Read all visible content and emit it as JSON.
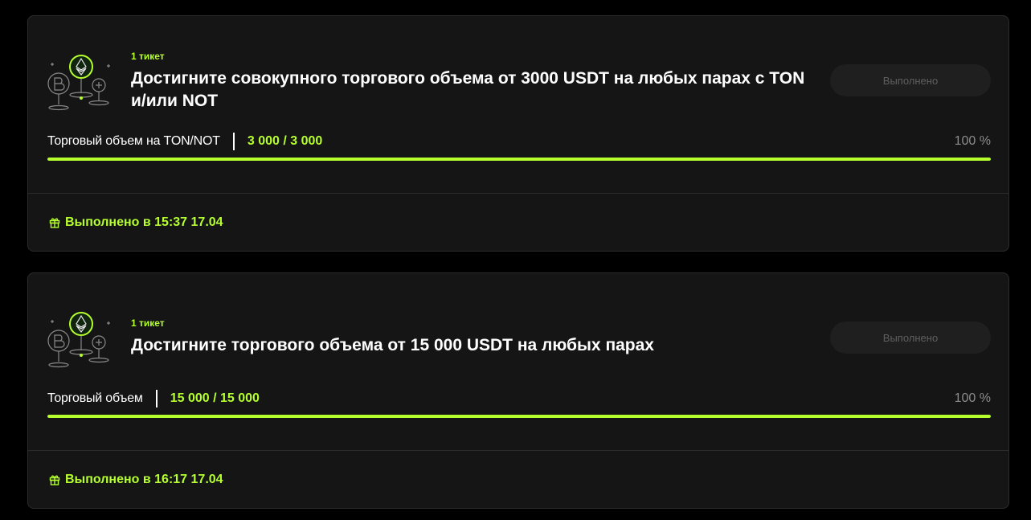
{
  "tasks": [
    {
      "ticket": "1 тикет",
      "title": "Достигните совокупного торгового объема от 3000 USDT на любых парах с TON и/или NOT",
      "button_label": "Выполнено",
      "progress_label": "Торговый объем на TON/NOT",
      "progress_value": "3 000 / 3 000",
      "progress_percent": "100 %",
      "progress_fraction": 1.0,
      "completed_text": "Выполнено в 15:37 17.04",
      "illustration_icon": "crypto-coins-illustration-icon",
      "completed_icon": "gift-icon"
    },
    {
      "ticket": "1 тикет",
      "title": "Достигните торгового объема от 15 000 USDT на любых парах",
      "button_label": "Выполнено",
      "progress_label": "Торговый объем",
      "progress_value": "15 000 / 15 000",
      "progress_percent": "100 %",
      "progress_fraction": 1.0,
      "completed_text": "Выполнено в 16:17 17.04",
      "illustration_icon": "crypto-coins-illustration-icon",
      "completed_icon": "gift-icon"
    }
  ],
  "colors": {
    "accent": "#b5ff2e",
    "card_bg": "#151515",
    "page_bg": "#000000",
    "muted": "#8c8c8c"
  }
}
